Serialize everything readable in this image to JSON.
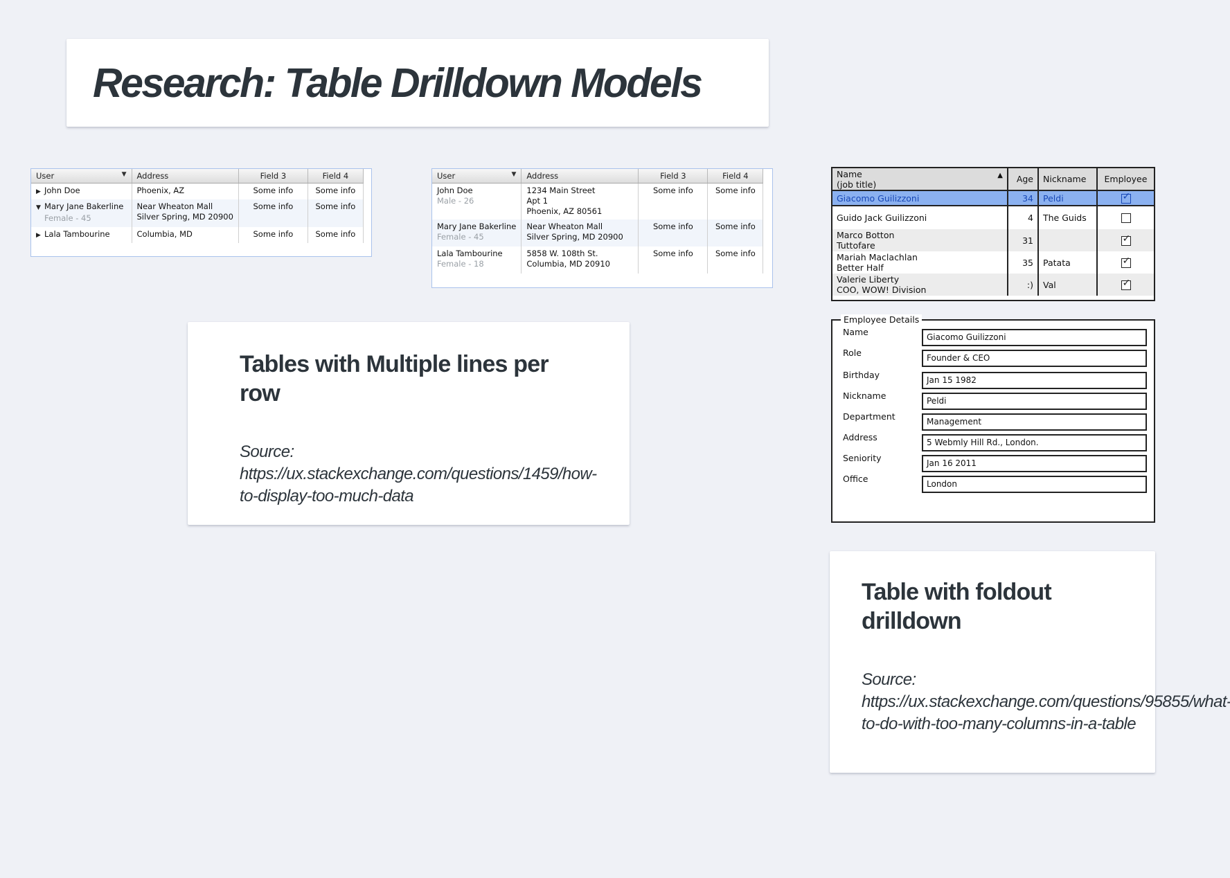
{
  "title": "Research: Table Drilldown Models",
  "note1": {
    "heading": "Tables with Multiple lines per row",
    "source": "Source: https://ux.stackexchange.com/questions/1459/how-to-display-too-much-data"
  },
  "note2": {
    "heading": "Table with foldout drilldown",
    "source": "Source: https://ux.stackexchange.com/questions/95855/what-to-do-with-too-many-columns-in-a-table"
  },
  "table1": {
    "headers": [
      "User",
      "Address",
      "Field 3",
      "Field 4"
    ],
    "rows": [
      {
        "user": "John Doe",
        "sub": "",
        "address": "Phoenix, AZ",
        "address2": "",
        "f3": "Some info",
        "f4": "Some info"
      },
      {
        "user": "Mary Jane Bakerline",
        "sub": "Female - 45",
        "address": "Near Wheaton Mall",
        "address2": "Silver Spring, MD 20900",
        "f3": "Some info",
        "f4": "Some info"
      },
      {
        "user": "Lala Tambourine",
        "sub": "",
        "address": "Columbia, MD",
        "address2": "",
        "f3": "Some info",
        "f4": "Some info"
      }
    ]
  },
  "table2": {
    "headers": [
      "User",
      "Address",
      "Field 3",
      "Field 4"
    ],
    "rows": [
      {
        "user": "John Doe",
        "sub": "Male - 26",
        "address": "1234 Main Street",
        "address2": "Apt 1",
        "address3": "Phoenix, AZ 80561",
        "f3": "Some info",
        "f4": "Some info"
      },
      {
        "user": "Mary Jane Bakerline",
        "sub": "Female - 45",
        "address": "Near Wheaton Mall",
        "address2": "Silver Spring, MD 20900",
        "address3": "",
        "f3": "Some info",
        "f4": "Some info"
      },
      {
        "user": "Lala Tambourine",
        "sub": "Female - 18",
        "address": "5858 W. 108th St.",
        "address2": "Columbia, MD 20910",
        "address3": "",
        "f3": "Some info",
        "f4": "Some info"
      }
    ]
  },
  "sketch": {
    "headers": {
      "name1": "Name",
      "name2": "(job title)",
      "age": "Age",
      "nickname": "Nickname",
      "employee": "Employee"
    },
    "rows": [
      {
        "name": "Giacomo Guilizzoni",
        "title": "",
        "age": "34",
        "nickname": "Peldi",
        "employee": true
      },
      {
        "name": "Guido Jack Guilizzoni",
        "title": "",
        "age": "4",
        "nickname": "The Guids",
        "employee": false
      },
      {
        "name": "Marco Botton",
        "title": "Tuttofare",
        "age": "31",
        "nickname": "",
        "employee": true
      },
      {
        "name": "Mariah Maclachlan",
        "title": "Better Half",
        "age": "35",
        "nickname": "Patata",
        "employee": true
      },
      {
        "name": "Valerie Liberty",
        "title": "COO, WOW! Division",
        "age": ":)",
        "nickname": "Val",
        "employee": true
      }
    ]
  },
  "details": {
    "legend": "Employee Details",
    "fields": [
      {
        "label": "Name",
        "value": "Giacomo Guilizzoni"
      },
      {
        "label": "Role",
        "value": "Founder & CEO"
      },
      {
        "label": "Birthday",
        "value": "Jan 15 1982"
      },
      {
        "label": "Nickname",
        "value": "Peldi"
      },
      {
        "label": "Department",
        "value": "Management"
      },
      {
        "label": "Address",
        "value": "5 Webmly Hill Rd., London."
      },
      {
        "label": "Seniority",
        "value": "Jan 16 2011"
      },
      {
        "label": "Office",
        "value": "London"
      }
    ]
  }
}
